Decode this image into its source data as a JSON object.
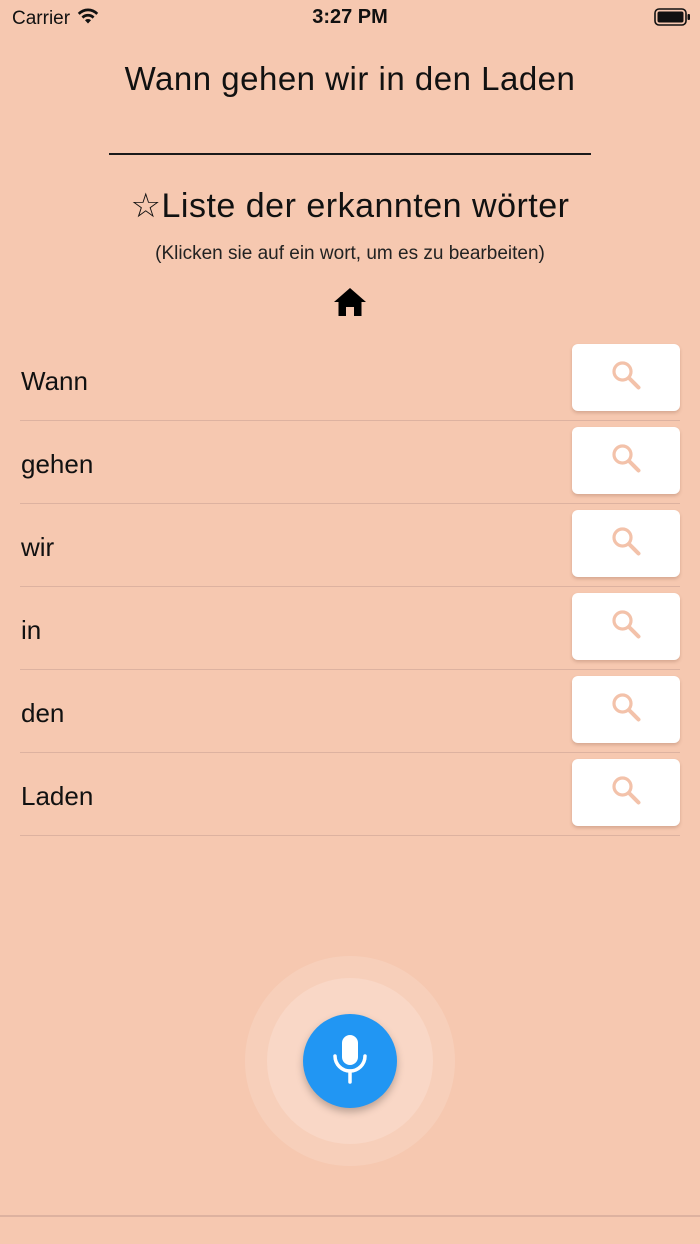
{
  "status_bar": {
    "carrier": "Carrier",
    "time": "3:27 PM"
  },
  "sentence": "Wann gehen wir in den Laden",
  "list": {
    "title": "☆Liste der erkannten wörter",
    "hint": "(Klicken sie auf ein wort, um es zu bearbeiten)"
  },
  "words": [
    "Wann",
    "gehen",
    "wir",
    "in",
    "den",
    "Laden"
  ],
  "icons": {
    "home": "home-icon",
    "search": "search-icon",
    "mic": "mic-icon",
    "wifi": "wifi-icon",
    "battery": "battery-icon"
  },
  "colors": {
    "background": "#f6c8b0",
    "mic_button": "#2196f3",
    "search_icon": "#f3c2aa"
  }
}
